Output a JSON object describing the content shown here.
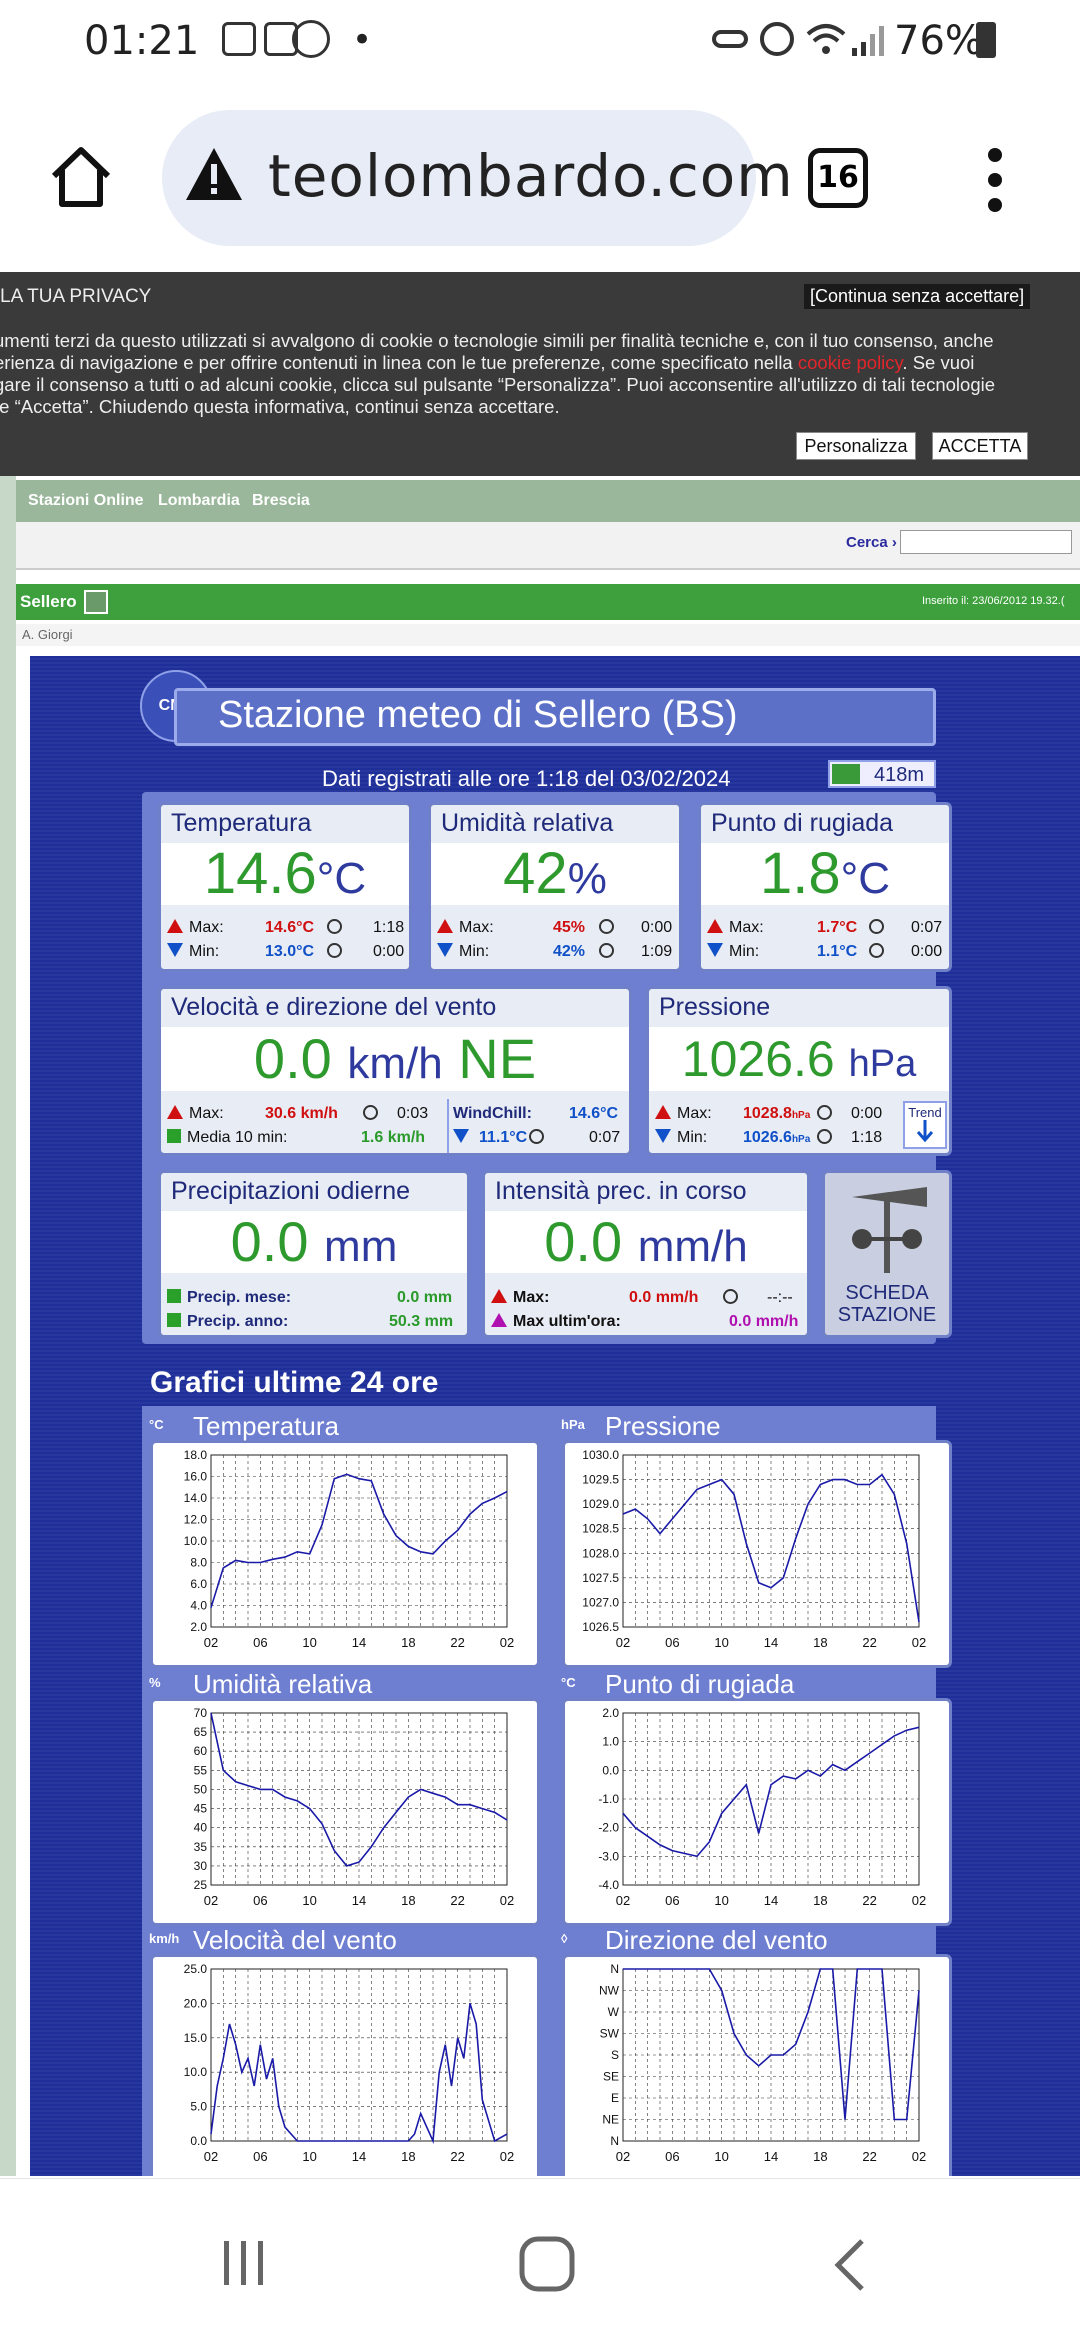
{
  "status": {
    "time": "01:21",
    "battery": "76%",
    "dot": "•"
  },
  "browser": {
    "url": "teolombardo.com",
    "tab_count": "16"
  },
  "privacy": {
    "title": "LA TUA PRIVACY",
    "continue_label": "[Continua senza accettare]",
    "text1": "umenti terzi da questo utilizzati si avvalgono di cookie o tecnologie simili per finalità tecniche e, con il tuo consenso, anche\nerienza di navigazione e per offrire contenuti in linea con le tue preferenze, come specificato nella ",
    "cookie_link": "cookie policy",
    "text2": ". Se vuoi\ngare il consenso a tutti o ad alcuni cookie, clicca sul pulsante “Personalizza”. Puoi acconsentire all'utilizzo di tali tecnologie\nte “Accetta”. Chiudendo questa informativa, continui senza accettare.",
    "personalize": "Personalizza",
    "accept": "ACCETTA"
  },
  "site": {
    "breadcrumbs": [
      "Stazioni Online",
      "Lombardia",
      "Brescia"
    ],
    "search_label": "Cerca ›",
    "station_name": "Sellero",
    "inserted": "Inserito il: 23/06/2012 19.32.(",
    "author": "A. Giorgi"
  },
  "station": {
    "logo_text": "CML",
    "title": "Stazione meteo di Sellero (BS)",
    "recorded": "Dati registrati alle ore 1:18 del 03/02/2024",
    "altitude": "418m",
    "temp": {
      "label": "Temperatura",
      "value": "14.6",
      "unit": "°C",
      "max_label": "Max:",
      "max": "14.6°C",
      "max_time": "1:18",
      "min_label": "Min:",
      "min": "13.0°C",
      "min_time": "0:00"
    },
    "hum": {
      "label": "Umidità relativa",
      "value": "42",
      "unit": "%",
      "max_label": "Max:",
      "max": "45%",
      "max_time": "0:00",
      "min_label": "Min:",
      "min": "42%",
      "min_time": "1:09"
    },
    "dew": {
      "label": "Punto di rugiada",
      "value": "1.8",
      "unit": "°C",
      "max_label": "Max:",
      "max": "1.7°C",
      "max_time": "0:07",
      "min_label": "Min:",
      "min": "1.1°C",
      "min_time": "0:00"
    },
    "wind": {
      "label": "Velocità e direzione del vento",
      "value": "0.0",
      "unit": "km/h",
      "dir": "NE",
      "max_label": "Max:",
      "max": "30.6 km/h",
      "max_time": "0:03",
      "avg_label": "Media 10 min:",
      "avg": "1.6 km/h",
      "wc_label": "WindChill:",
      "wc": "14.6°C",
      "wc_min": "11.1°C",
      "wc_time": "0:07"
    },
    "press": {
      "label": "Pressione",
      "value": "1026.6",
      "unit": "hPa",
      "max_label": "Max:",
      "max": "1028.8",
      "max_unit": "hPa",
      "max_time": "0:00",
      "min_label": "Min:",
      "min": "1026.6",
      "min_unit": "hPa",
      "min_time": "1:18",
      "trend": "Trend"
    },
    "rain": {
      "label": "Precipitazioni odierne",
      "value": "0.0",
      "unit": "mm",
      "month_label": "Precip. mese:",
      "month": "0.0 mm",
      "year_label": "Precip. anno:",
      "year": "50.3 mm"
    },
    "rate": {
      "label": "Intensità prec. in corso",
      "value": "0.0",
      "unit": "mm/h",
      "max_label": "Max:",
      "max": "0.0 mm/h",
      "max_time": "--:--",
      "maxh_label": "Max ultim'ora:",
      "maxh": "0.0 mm/h"
    },
    "sheet": {
      "line1": "SCHEDA",
      "line2": "STAZIONE"
    },
    "graphs_title": "Grafici ultime 24 ore"
  },
  "chart_data": [
    {
      "type": "line",
      "title": "Temperatura",
      "unit": "°C",
      "x_ticks": [
        "02",
        "06",
        "10",
        "14",
        "18",
        "22",
        "02"
      ],
      "y_ticks": [
        "18.0",
        "16.0",
        "14.0",
        "12.0",
        "10.0",
        "8.0",
        "6.0",
        "4.0",
        "2.0"
      ],
      "ylim": [
        2,
        18
      ],
      "x": [
        2,
        3,
        4,
        5,
        6,
        7,
        8,
        9,
        10,
        11,
        12,
        13,
        14,
        15,
        16,
        17,
        18,
        19,
        20,
        21,
        22,
        23,
        24,
        25,
        26
      ],
      "values": [
        3.8,
        7.5,
        8.2,
        8.0,
        8.0,
        8.3,
        8.5,
        9.0,
        8.8,
        11.5,
        15.8,
        16.2,
        15.8,
        15.6,
        12.5,
        10.5,
        9.5,
        9.0,
        8.8,
        10.0,
        11.0,
        12.5,
        13.5,
        14.0,
        14.6
      ]
    },
    {
      "type": "line",
      "title": "Pressione",
      "unit": "hPa",
      "x_ticks": [
        "02",
        "06",
        "10",
        "14",
        "18",
        "22",
        "02"
      ],
      "y_ticks": [
        "1030.0",
        "1029.5",
        "1029.0",
        "1028.5",
        "1028.0",
        "1027.5",
        "1027.0",
        "1026.5"
      ],
      "ylim": [
        1026.5,
        1030
      ],
      "x": [
        2,
        3,
        4,
        5,
        6,
        7,
        8,
        9,
        10,
        11,
        12,
        13,
        14,
        15,
        16,
        17,
        18,
        19,
        20,
        21,
        22,
        23,
        24,
        25,
        26
      ],
      "values": [
        1028.8,
        1028.9,
        1028.7,
        1028.4,
        1028.7,
        1029.0,
        1029.3,
        1029.4,
        1029.5,
        1029.2,
        1028.2,
        1027.4,
        1027.3,
        1027.5,
        1028.3,
        1029.0,
        1029.4,
        1029.5,
        1029.5,
        1029.4,
        1029.4,
        1029.6,
        1029.2,
        1028.2,
        1026.6
      ]
    },
    {
      "type": "line",
      "title": "Umidità relativa",
      "unit": "%",
      "x_ticks": [
        "02",
        "06",
        "10",
        "14",
        "18",
        "22",
        "02"
      ],
      "y_ticks": [
        "70",
        "65",
        "60",
        "55",
        "50",
        "45",
        "40",
        "35",
        "30",
        "25"
      ],
      "ylim": [
        25,
        70
      ],
      "x": [
        2,
        3,
        4,
        5,
        6,
        7,
        8,
        9,
        10,
        11,
        12,
        13,
        14,
        15,
        16,
        17,
        18,
        19,
        20,
        21,
        22,
        23,
        24,
        25,
        26
      ],
      "values": [
        70,
        55,
        52,
        51,
        50,
        50,
        48,
        47,
        45,
        41,
        34,
        30,
        31,
        35,
        40,
        44,
        48,
        50,
        49,
        48,
        46,
        46,
        45,
        44,
        42
      ]
    },
    {
      "type": "line",
      "title": "Punto di rugiada",
      "unit": "°C",
      "x_ticks": [
        "02",
        "06",
        "10",
        "14",
        "18",
        "22",
        "02"
      ],
      "y_ticks": [
        "2.0",
        "1.0",
        "0.0",
        "-1.0",
        "-2.0",
        "-3.0",
        "-4.0"
      ],
      "ylim": [
        -4,
        2
      ],
      "x": [
        2,
        3,
        4,
        5,
        6,
        7,
        8,
        9,
        10,
        11,
        12,
        13,
        14,
        15,
        16,
        17,
        18,
        19,
        20,
        21,
        22,
        23,
        24,
        25,
        26
      ],
      "values": [
        -1.5,
        -2.0,
        -2.3,
        -2.6,
        -2.8,
        -2.9,
        -3.0,
        -2.5,
        -1.5,
        -1.0,
        -0.5,
        -2.2,
        -0.5,
        -0.2,
        -0.3,
        0.0,
        -0.2,
        0.2,
        0.0,
        0.3,
        0.6,
        0.9,
        1.2,
        1.4,
        1.5
      ]
    },
    {
      "type": "line",
      "title": "Velocità del vento",
      "unit": "km/h",
      "x_ticks": [
        "02",
        "06",
        "10",
        "14",
        "18",
        "22",
        "02"
      ],
      "y_ticks": [
        "25.0",
        "20.0",
        "15.0",
        "10.0",
        "5.0",
        "0.0"
      ],
      "ylim": [
        0,
        25
      ],
      "x": [
        2,
        2.5,
        3,
        3.5,
        4,
        4.5,
        5,
        5.5,
        6,
        6.5,
        7,
        7.5,
        8,
        9,
        10,
        11,
        12,
        13,
        14,
        15,
        16,
        17,
        18,
        18.5,
        19,
        19.5,
        20,
        20.5,
        21,
        21.5,
        22,
        22.5,
        23,
        23.5,
        24,
        25,
        26
      ],
      "values": [
        1,
        8,
        12,
        17,
        14,
        10,
        12,
        8,
        14,
        9,
        12,
        5,
        2,
        0,
        0,
        0,
        0,
        0,
        0,
        0,
        0,
        0,
        0,
        1,
        4,
        2,
        0,
        10,
        14,
        8,
        15,
        12,
        20,
        17,
        6,
        0,
        1
      ]
    },
    {
      "type": "line",
      "title": "Direzione del vento",
      "unit": "",
      "x_ticks": [
        "02",
        "06",
        "10",
        "14",
        "18",
        "22",
        "02"
      ],
      "y_ticks": [
        "N",
        "NW",
        "W",
        "SW",
        "S",
        "SE",
        "E",
        "NE",
        "N"
      ],
      "ylim": [
        0,
        8
      ],
      "x": [
        2,
        3,
        4,
        5,
        6,
        7,
        8,
        9,
        10,
        11,
        12,
        13,
        14,
        15,
        16,
        17,
        18,
        19,
        20,
        21,
        22,
        23,
        24,
        25,
        26
      ],
      "values": [
        8,
        8,
        8,
        8,
        8,
        8,
        8,
        8,
        7,
        5,
        4,
        3.5,
        4,
        4,
        4.5,
        6,
        8,
        8,
        1,
        8,
        8,
        8,
        1,
        1,
        7
      ]
    }
  ]
}
